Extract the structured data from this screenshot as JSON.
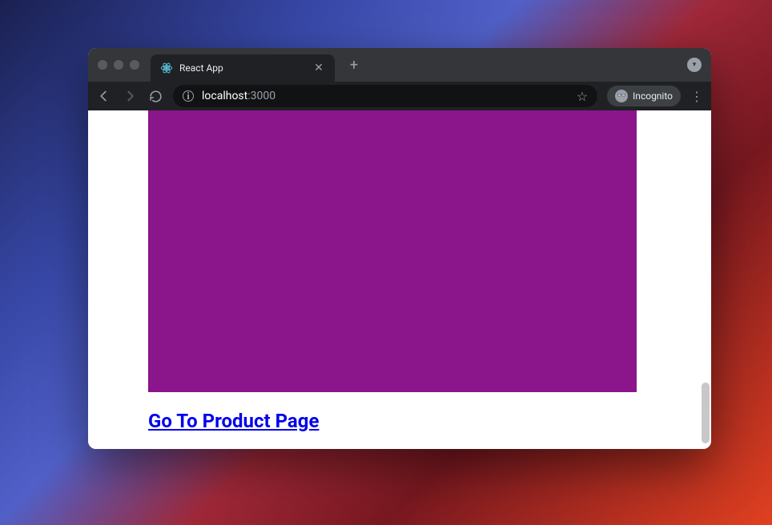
{
  "browser": {
    "tab_title": "React App",
    "url_host": "localhost",
    "url_port": ":3000",
    "incognito_label": "Incognito"
  },
  "page": {
    "link_text": "Go To Product Page",
    "box_color": "#8b158b"
  }
}
